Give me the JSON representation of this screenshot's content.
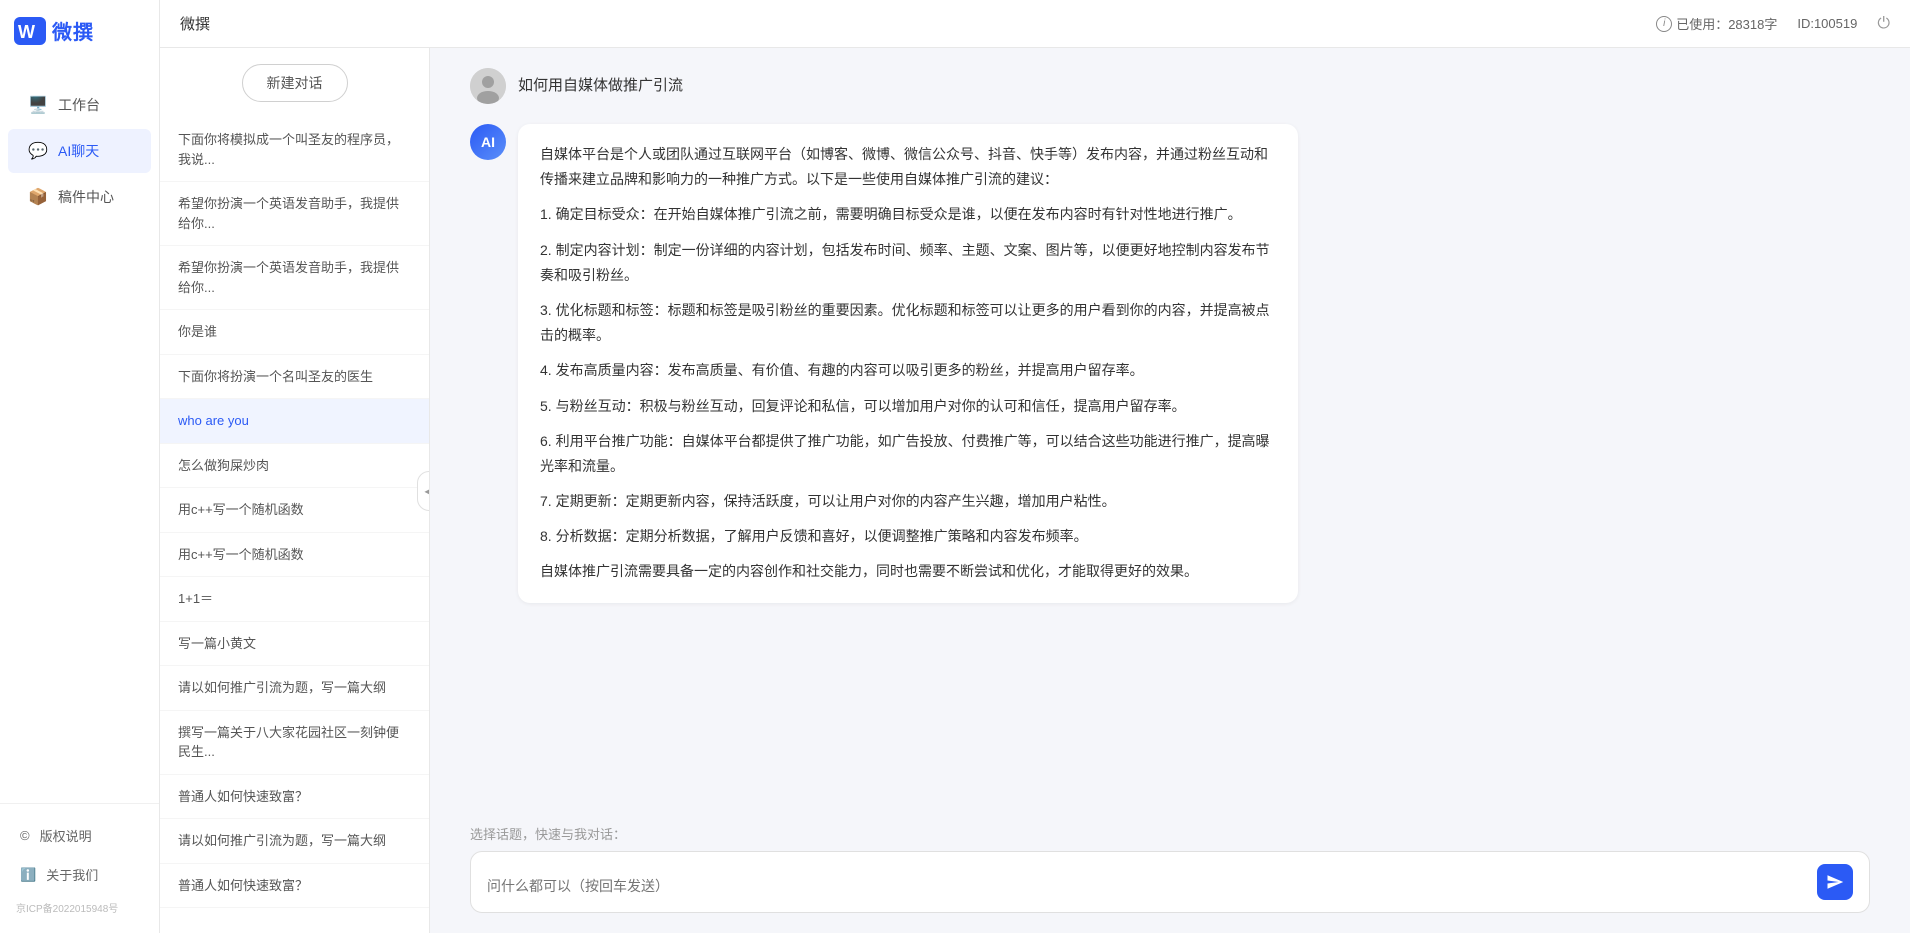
{
  "sidebar": {
    "logo_text": "微撰",
    "nav_items": [
      {
        "id": "workbench",
        "label": "工作台",
        "icon": "🖥️",
        "active": false
      },
      {
        "id": "ai-chat",
        "label": "AI聊天",
        "icon": "💬",
        "active": true
      },
      {
        "id": "mailbox",
        "label": "稿件中心",
        "icon": "📦",
        "active": false
      }
    ],
    "bottom_items": [
      {
        "id": "copyright",
        "label": "版权说明",
        "icon": "©"
      },
      {
        "id": "about",
        "label": "关于我们",
        "icon": "ℹ️"
      }
    ],
    "icp": "京ICP备2022015948号"
  },
  "header": {
    "title": "微撰",
    "usage_label": "已使用：28318字",
    "id_label": "ID:100519",
    "usage_icon": "i"
  },
  "history": {
    "new_chat": "新建对话",
    "items": [
      {
        "id": 1,
        "text": "下面你将模拟成一个叫圣友的程序员，我说...",
        "active": false
      },
      {
        "id": 2,
        "text": "希望你扮演一个英语发音助手，我提供给你...",
        "active": false
      },
      {
        "id": 3,
        "text": "希望你扮演一个英语发音助手，我提供给你...",
        "active": false
      },
      {
        "id": 4,
        "text": "你是谁",
        "active": false
      },
      {
        "id": 5,
        "text": "下面你将扮演一个名叫圣友的医生",
        "active": false
      },
      {
        "id": 6,
        "text": "who are you",
        "active": true
      },
      {
        "id": 7,
        "text": "怎么做狗屎炒肉",
        "active": false
      },
      {
        "id": 8,
        "text": "用c++写一个随机函数",
        "active": false
      },
      {
        "id": 9,
        "text": "用c++写一个随机函数",
        "active": false
      },
      {
        "id": 10,
        "text": "1+1＝",
        "active": false
      },
      {
        "id": 11,
        "text": "写一篇小黄文",
        "active": false
      },
      {
        "id": 12,
        "text": "请以如何推广引流为题，写一篇大纲",
        "active": false
      },
      {
        "id": 13,
        "text": "撰写一篇关于八大家花园社区一刻钟便民生...",
        "active": false
      },
      {
        "id": 14,
        "text": "普通人如何快速致富？",
        "active": false
      },
      {
        "id": 15,
        "text": "请以如何推广引流为题，写一篇大纲",
        "active": false
      },
      {
        "id": 16,
        "text": "普通人如何快速致富？",
        "active": false
      }
    ]
  },
  "chat": {
    "user_question": "如何用自媒体做推广引流",
    "ai_response_paragraphs": [
      "自媒体平台是个人或团队通过互联网平台（如博客、微博、微信公众号、抖音、快手等）发布内容，并通过粉丝互动和传播来建立品牌和影响力的一种推广方式。以下是一些使用自媒体推广引流的建议：",
      "1. 确定目标受众：在开始自媒体推广引流之前，需要明确目标受众是谁，以便在发布内容时有针对性地进行推广。",
      "2. 制定内容计划：制定一份详细的内容计划，包括发布时间、频率、主题、文案、图片等，以便更好地控制内容发布节奏和吸引粉丝。",
      "3. 优化标题和标签：标题和标签是吸引粉丝的重要因素。优化标题和标签可以让更多的用户看到你的内容，并提高被点击的概率。",
      "4. 发布高质量内容：发布高质量、有价值、有趣的内容可以吸引更多的粉丝，并提高用户留存率。",
      "5. 与粉丝互动：积极与粉丝互动，回复评论和私信，可以增加用户对你的认可和信任，提高用户留存率。",
      "6. 利用平台推广功能：自媒体平台都提供了推广功能，如广告投放、付费推广等，可以结合这些功能进行推广，提高曝光率和流量。",
      "7. 定期更新：定期更新内容，保持活跃度，可以让用户对你的内容产生兴趣，增加用户粘性。",
      "8. 分析数据：定期分析数据，了解用户反馈和喜好，以便调整推广策略和内容发布频率。",
      "自媒体推广引流需要具备一定的内容创作和社交能力，同时也需要不断尝试和优化，才能取得更好的效果。"
    ],
    "input_placeholder": "问什么都可以（按回车发送）",
    "quick_topic_label": "选择话题，快速与我对话："
  }
}
